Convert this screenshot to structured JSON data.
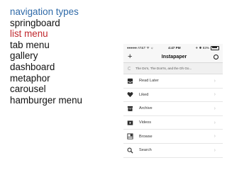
{
  "left_list": {
    "items": [
      {
        "text": "navigation types",
        "style": "blue"
      },
      {
        "text": "springboard",
        "style": "normal"
      },
      {
        "text": "list menu",
        "style": "red"
      },
      {
        "text": "tab menu",
        "style": "normal"
      },
      {
        "text": "gallery",
        "style": "normal"
      },
      {
        "text": "dashboard",
        "style": "normal"
      },
      {
        "text": "metaphor",
        "style": "normal"
      },
      {
        "text": "carousel",
        "style": "normal"
      },
      {
        "text": "hamburger menu",
        "style": "normal"
      }
    ],
    "colors": {
      "blue": "#2f6aa8",
      "red": "#c0282d",
      "normal": "#111111"
    }
  },
  "phone": {
    "status_bar": {
      "carrier": "●●●●● AT&T ᯤ ☼",
      "time": "4:47 PM",
      "battery_text": "✈ ✱ 83%"
    },
    "nav_bar": {
      "plus": "+",
      "title": "Instapaper",
      "right_icon": "settings-ring-icon"
    },
    "preview_text": "The Do's, The Don'ts, and the Oh Go...",
    "menu": [
      {
        "label": "Read Later",
        "icon": "inbox-tray-icon"
      },
      {
        "label": "Liked",
        "icon": "heart-icon"
      },
      {
        "label": "Archive",
        "icon": "archive-box-icon"
      },
      {
        "label": "Videos",
        "icon": "video-play-icon"
      },
      {
        "label": "Browse",
        "icon": "browse-grid-icon"
      },
      {
        "label": "Search",
        "icon": "magnifier-icon"
      }
    ],
    "chevron": "›"
  }
}
